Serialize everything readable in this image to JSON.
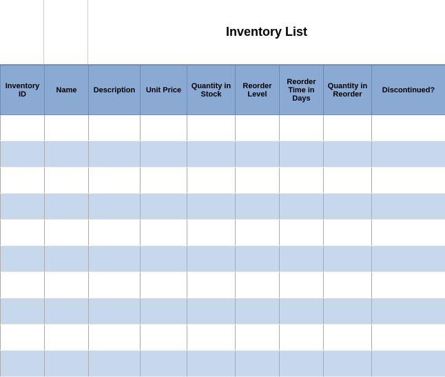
{
  "title": "Inventory List",
  "columns": [
    "Inventory ID",
    "Name",
    "Description",
    "Unit Price",
    "Quantity in Stock",
    "Reorder Level",
    "Reorder Time in Days",
    "Quantity in Reorder",
    "Discontinued?"
  ],
  "rows": [
    [
      "",
      "",
      "",
      "",
      "",
      "",
      "",
      "",
      ""
    ],
    [
      "",
      "",
      "",
      "",
      "",
      "",
      "",
      "",
      ""
    ],
    [
      "",
      "",
      "",
      "",
      "",
      "",
      "",
      "",
      ""
    ],
    [
      "",
      "",
      "",
      "",
      "",
      "",
      "",
      "",
      ""
    ],
    [
      "",
      "",
      "",
      "",
      "",
      "",
      "",
      "",
      ""
    ],
    [
      "",
      "",
      "",
      "",
      "",
      "",
      "",
      "",
      ""
    ],
    [
      "",
      "",
      "",
      "",
      "",
      "",
      "",
      "",
      ""
    ],
    [
      "",
      "",
      "",
      "",
      "",
      "",
      "",
      "",
      ""
    ],
    [
      "",
      "",
      "",
      "",
      "",
      "",
      "",
      "",
      ""
    ],
    [
      "",
      "",
      "",
      "",
      "",
      "",
      "",
      "",
      ""
    ]
  ]
}
